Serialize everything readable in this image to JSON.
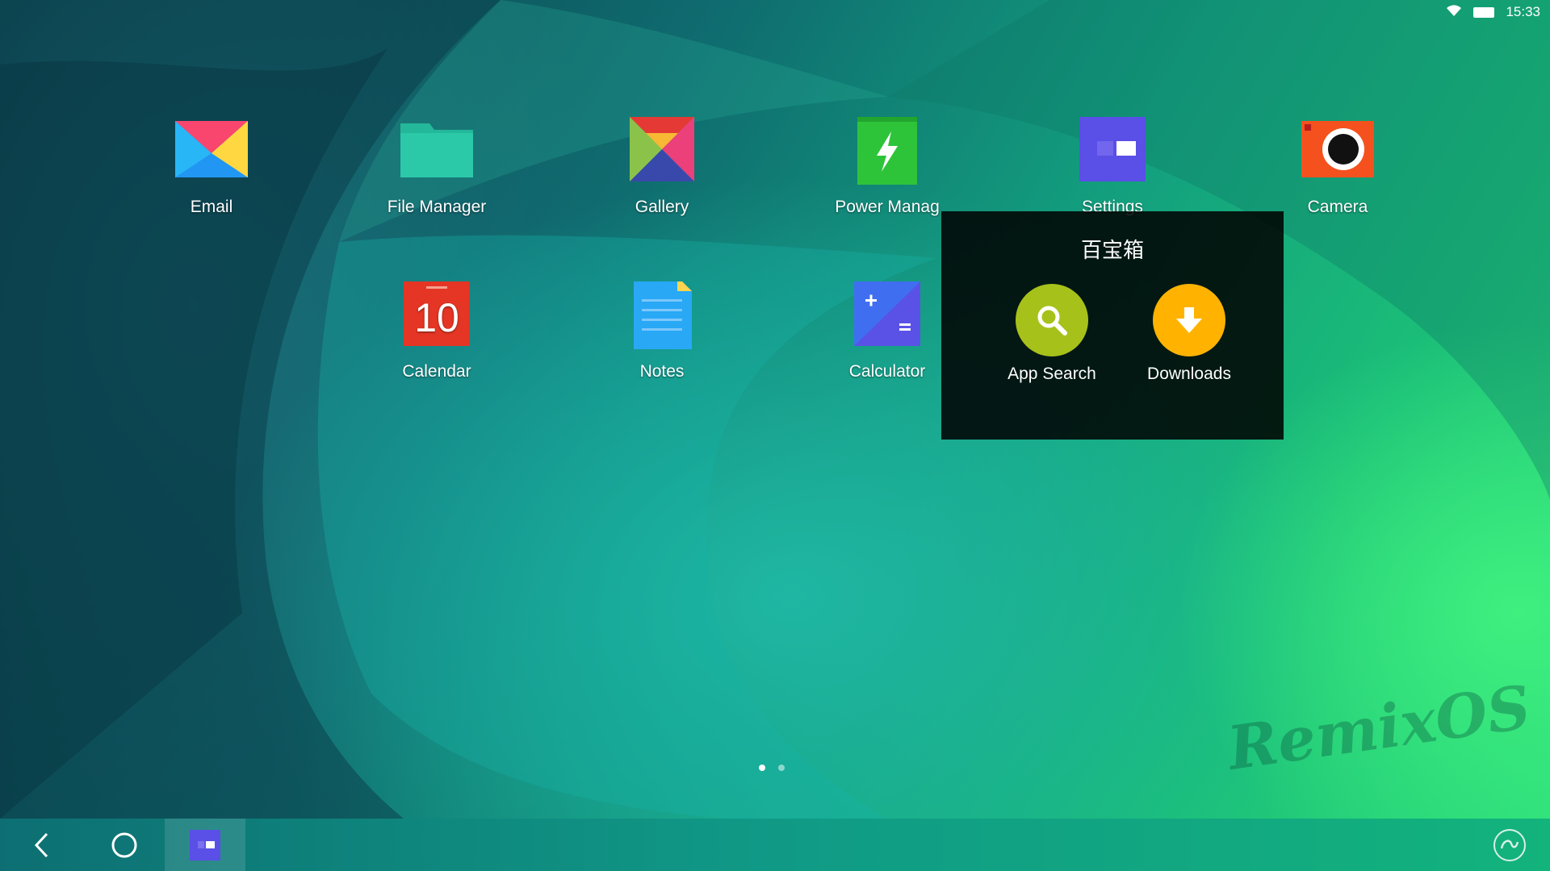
{
  "status": {
    "time": "15:33",
    "wifi_icon": "wifi-icon",
    "battery_icon": "battery-icon"
  },
  "apps": [
    {
      "label": "Email",
      "icon": "email-icon"
    },
    {
      "label": "File Manager",
      "icon": "folder-icon"
    },
    {
      "label": "Gallery",
      "icon": "gallery-icon"
    },
    {
      "label": "Power Manag",
      "icon": "power-icon"
    },
    {
      "label": "Settings",
      "icon": "settings-icon"
    },
    {
      "label": "Camera",
      "icon": "camera-icon"
    },
    {
      "label": "Calendar",
      "icon": "calendar-icon",
      "date": "10"
    },
    {
      "label": "Notes",
      "icon": "notes-icon"
    },
    {
      "label": "Calculator",
      "icon": "calculator-icon"
    }
  ],
  "folder": {
    "title": "百宝箱",
    "items": [
      {
        "label": "App Search",
        "icon": "search-icon",
        "color": "#a7c11b"
      },
      {
        "label": "Downloads",
        "icon": "download-icon",
        "color": "#ffb300"
      }
    ]
  },
  "watermark": "RemixOS",
  "page_indicator": {
    "pages": 2,
    "current": 1
  },
  "navbar": {
    "back_icon": "back-icon",
    "home_icon": "home-icon",
    "recent_icon": "recent-app-icon",
    "corner_icon": "remix-logo-icon"
  }
}
